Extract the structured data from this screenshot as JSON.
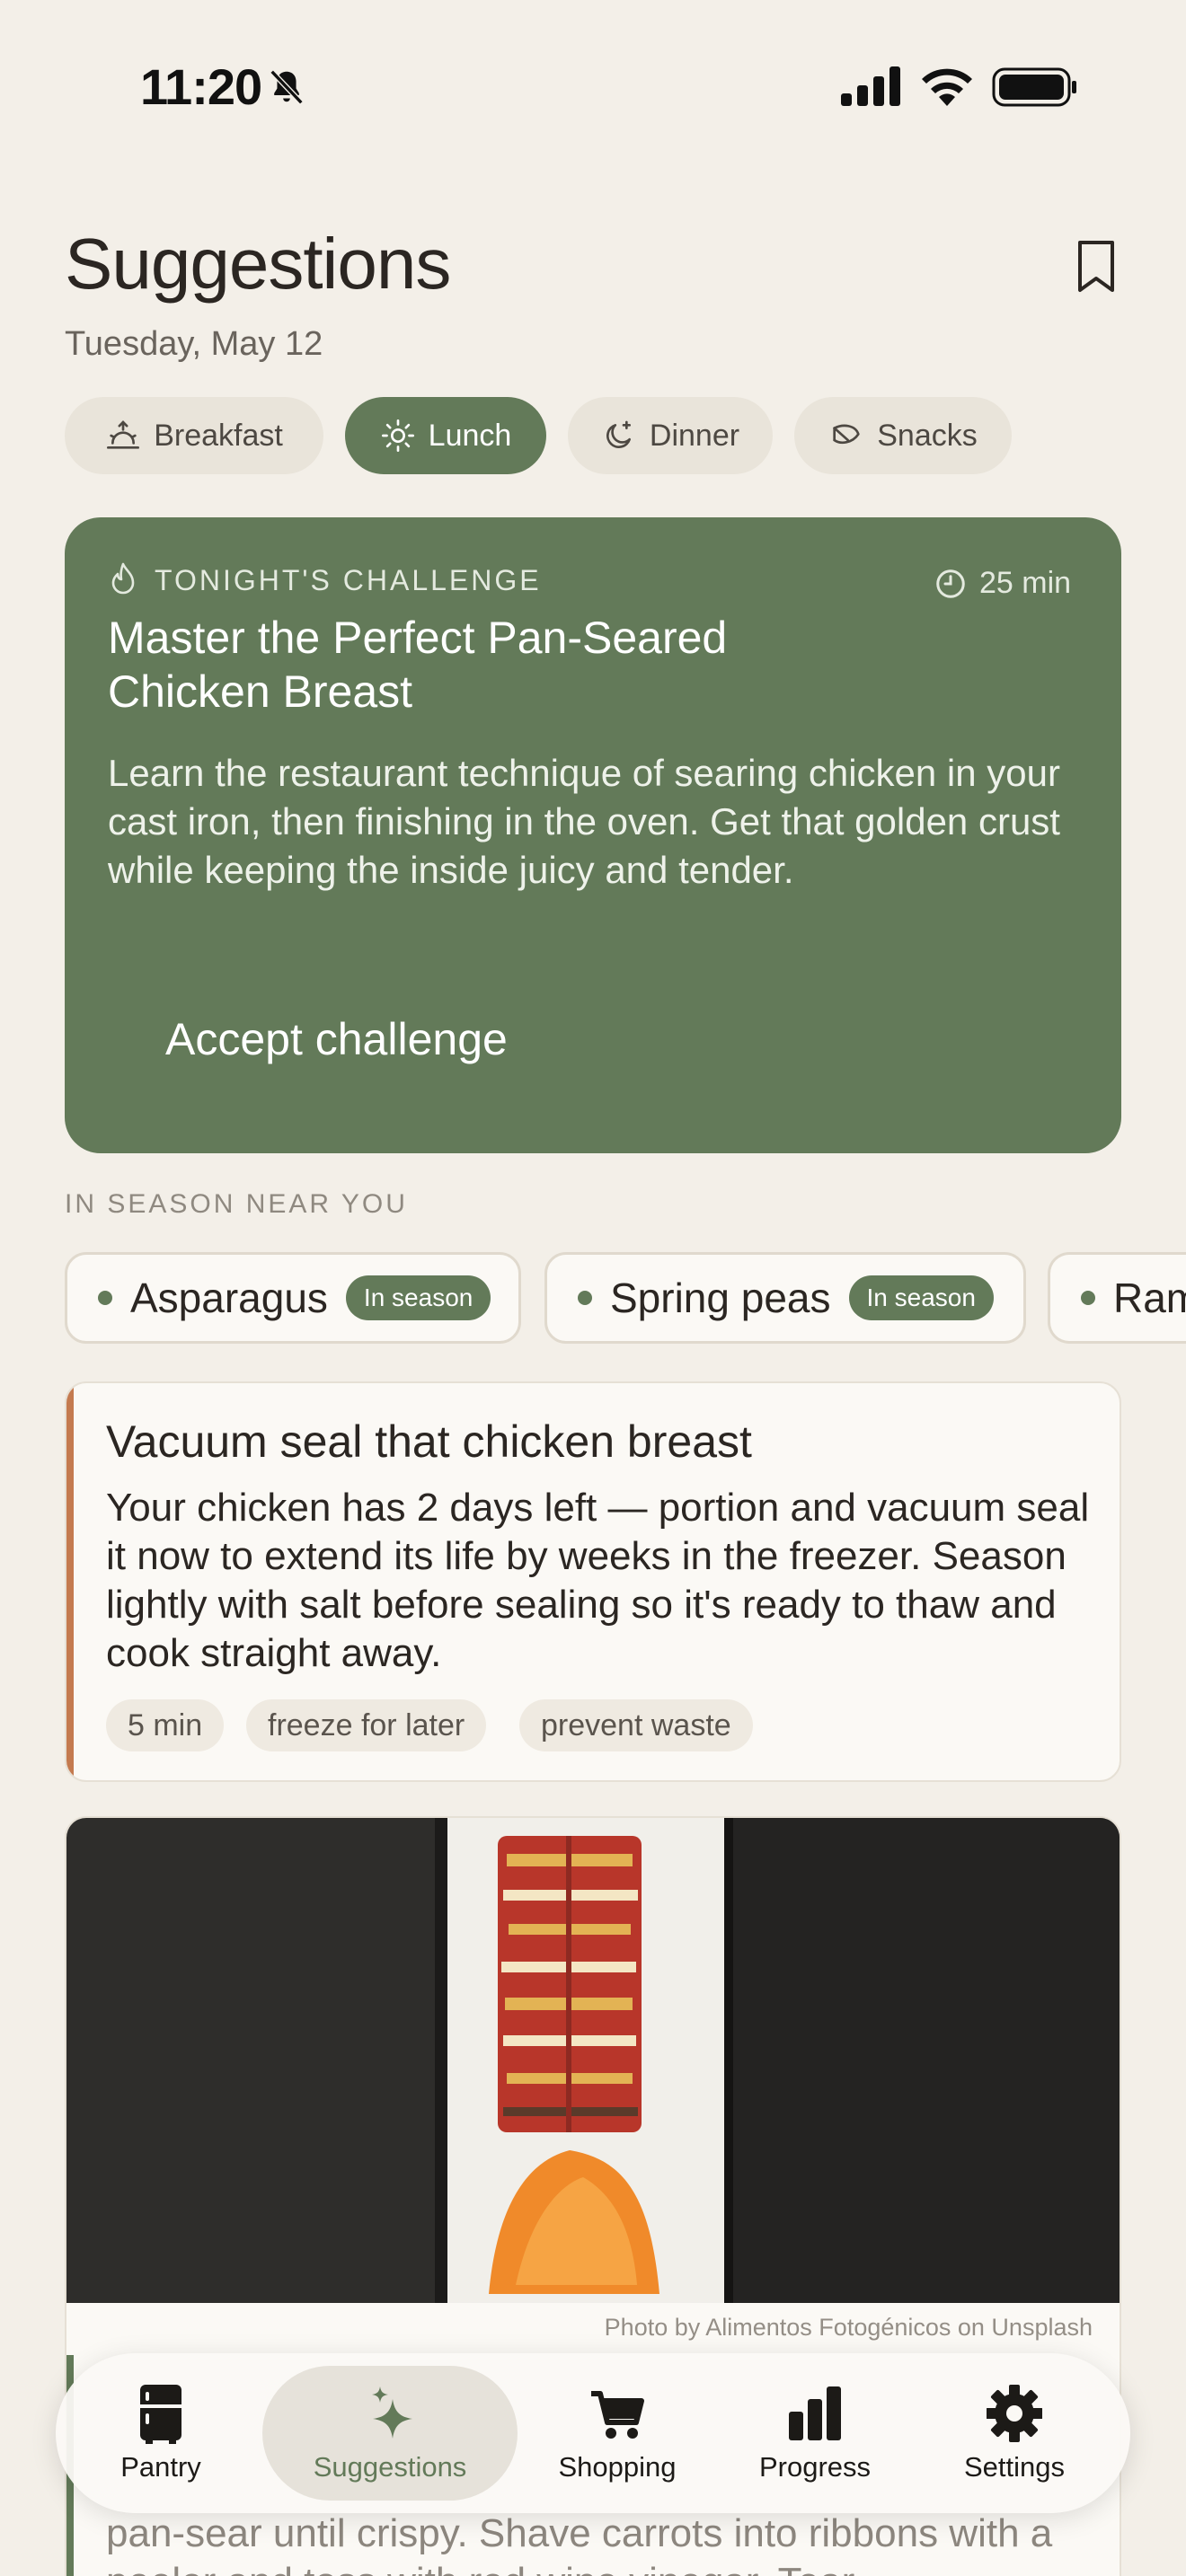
{
  "status_bar": {
    "time": "11:20"
  },
  "header": {
    "title": "Suggestions",
    "date": "Tuesday, May 12"
  },
  "meal_tabs": [
    {
      "label": "Breakfast",
      "icon": "sunrise-icon",
      "selected": false
    },
    {
      "label": "Lunch",
      "icon": "sun-icon",
      "selected": true
    },
    {
      "label": "Dinner",
      "icon": "moon-icon",
      "selected": false
    },
    {
      "label": "Snacks",
      "icon": "leaf-icon",
      "selected": false
    }
  ],
  "challenge": {
    "label": "TONIGHT'S CHALLENGE",
    "time": "25 min",
    "title": "Master the Perfect Pan-Seared Chicken Breast",
    "description": "Learn the restaurant technique of searing chicken in your cast iron, then finishing in the oven. Get that golden crust while keeping the inside juicy and tender.",
    "button": "Accept challenge"
  },
  "season": {
    "heading": "IN SEASON NEAR YOU",
    "items": [
      {
        "name": "Asparagus",
        "badge": "In season"
      },
      {
        "name": "Spring peas",
        "badge": "In season"
      },
      {
        "name": "Ram"
      }
    ]
  },
  "tip": {
    "title": "Vacuum seal that chicken breast",
    "description": "Your chicken has 2 days left — portion and vacuum seal it now to extend its life by weeks in the freezer. Season lightly with salt before sealing so it's ready to thaw and cook straight away.",
    "tags": [
      "5 min",
      "freeze for later",
      "prevent waste"
    ]
  },
  "recipe_card": {
    "photo_credit": "Photo by Alimentos Fotogénicos on Unsplash",
    "description_partial": "pan-sear until crispy. Shave carrots into ribbons with a peeler and toss with red wine vinegar. Tear"
  },
  "tabbar": [
    {
      "label": "Pantry",
      "icon": "fridge-icon",
      "selected": false
    },
    {
      "label": "Suggestions",
      "icon": "sparkles-icon",
      "selected": true
    },
    {
      "label": "Shopping",
      "icon": "cart-icon",
      "selected": false
    },
    {
      "label": "Progress",
      "icon": "bar-chart-icon",
      "selected": false
    },
    {
      "label": "Settings",
      "icon": "gear-icon",
      "selected": false
    }
  ],
  "colors": {
    "accent": "#637a59",
    "background": "#f3efe8",
    "tip_accent": "#c47a4f"
  }
}
